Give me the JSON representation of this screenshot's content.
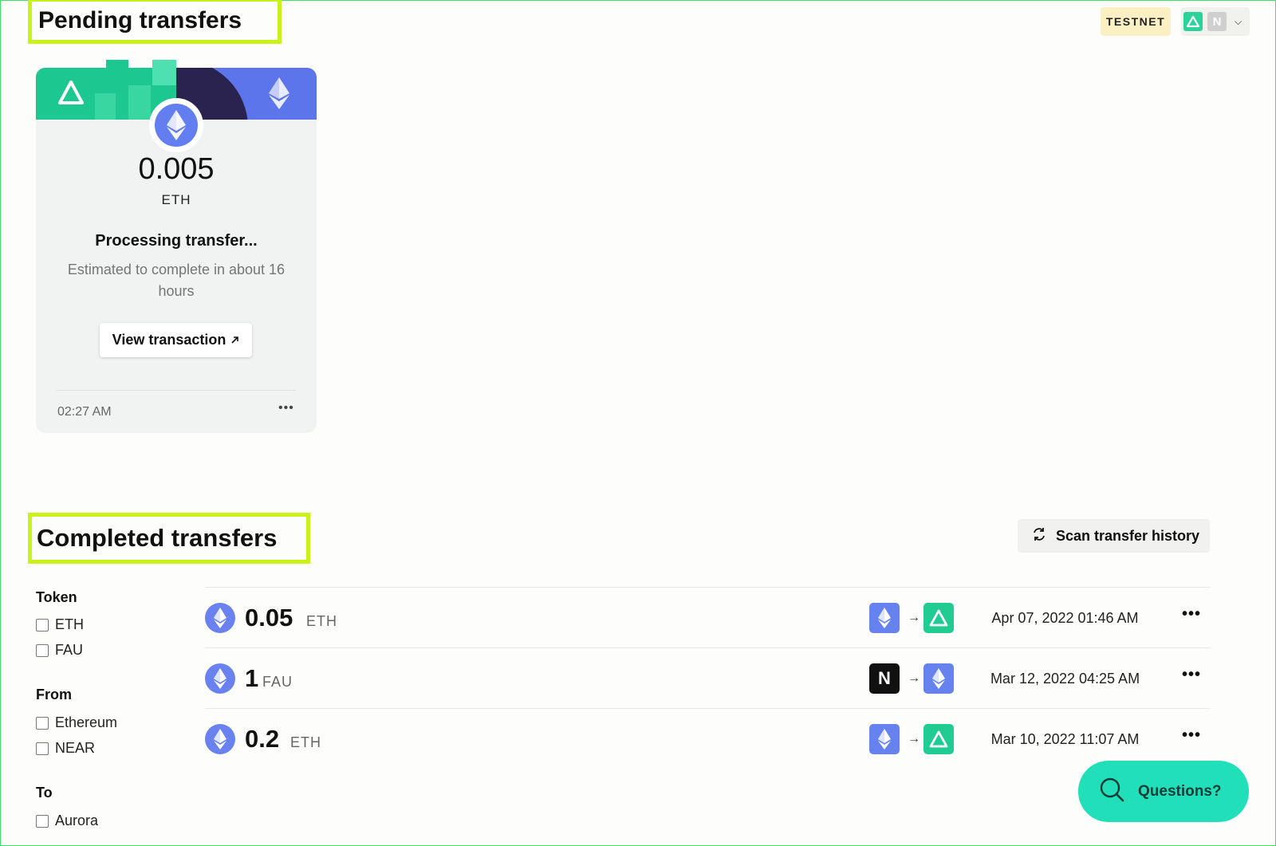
{
  "pending": {
    "title": "Pending transfers",
    "card": {
      "amount": "0.005",
      "symbol": "ETH",
      "status": "Processing transfer...",
      "description": "Estimated to complete in about 16 hours",
      "view_button": "View transaction",
      "time": "02:27 AM",
      "more": "•••"
    }
  },
  "header": {
    "network_badge": "TESTNET",
    "wallet_icons": [
      "aurora-icon",
      "near-icon"
    ]
  },
  "completed": {
    "title": "Completed transfers",
    "scan_button": "Scan transfer history",
    "filters": {
      "token": {
        "label": "Token",
        "options": [
          "ETH",
          "FAU"
        ]
      },
      "from": {
        "label": "From",
        "options": [
          "Ethereum",
          "NEAR"
        ]
      },
      "to": {
        "label": "To",
        "options": [
          "Aurora"
        ]
      }
    },
    "rows": [
      {
        "amount": "0.05",
        "symbol": "ETH",
        "from": "ethereum",
        "to": "aurora",
        "date": "Apr 07, 2022 01:46 AM",
        "more": "•••"
      },
      {
        "amount": "1",
        "symbol": "FAU",
        "from": "near",
        "to": "ethereum",
        "date": "Mar 12, 2022 04:25 AM",
        "more": "•••"
      },
      {
        "amount": "0.2",
        "symbol": "ETH",
        "from": "ethereum",
        "to": "aurora",
        "date": "Mar 10, 2022 11:07 AM",
        "more": "•••"
      }
    ]
  },
  "help": {
    "questions_button": "Questions?"
  },
  "colors": {
    "highlight": "#c8f21a",
    "aurora_green": "#20cc92",
    "eth_blue": "#6582ee",
    "testnet_bg": "#fbf0c4",
    "questions_bg": "#20dfb9"
  }
}
